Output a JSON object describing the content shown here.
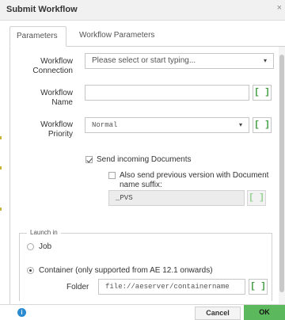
{
  "dialog": {
    "title": "Submit Workflow",
    "close_glyph": "×"
  },
  "tabs": [
    {
      "label": "Parameters",
      "active": true
    },
    {
      "label": "Workflow Parameters",
      "active": false
    }
  ],
  "form": {
    "connection": {
      "label_line1": "Workflow",
      "label_line2": "Connection",
      "placeholder": "Please select or start typing...",
      "caret": "▾"
    },
    "name": {
      "label_line1": "Workflow",
      "label_line2": "Name",
      "value": "",
      "bracket": "[ ]"
    },
    "priority": {
      "label_line1": "Workflow",
      "label_line2": "Priority",
      "value": "Normal",
      "caret": "▾",
      "bracket": "[ ]"
    },
    "send_docs": {
      "label": "Send incoming Documents",
      "checked": true
    },
    "prev_version": {
      "label_line1": "Also send previous version with Document",
      "label_line2": "name suffix:",
      "checked": false,
      "suffix_value": "_PVS",
      "bracket": "[ ]"
    }
  },
  "launch_in": {
    "legend": "Launch in",
    "job_label": "Job",
    "container_label": "Container (only supported from AE 12.1 onwards)",
    "selected": "container",
    "folder_label": "Folder",
    "folder_value": "file://aeserver/containername",
    "bracket": "[ ]"
  },
  "footer": {
    "info_glyph": "i",
    "cancel_label": "Cancel",
    "ok_label": "OK"
  },
  "colors": {
    "accent_green": "#5cb85c",
    "bracket_green": "#3a9a3a",
    "info_blue": "#2a8bd1"
  }
}
